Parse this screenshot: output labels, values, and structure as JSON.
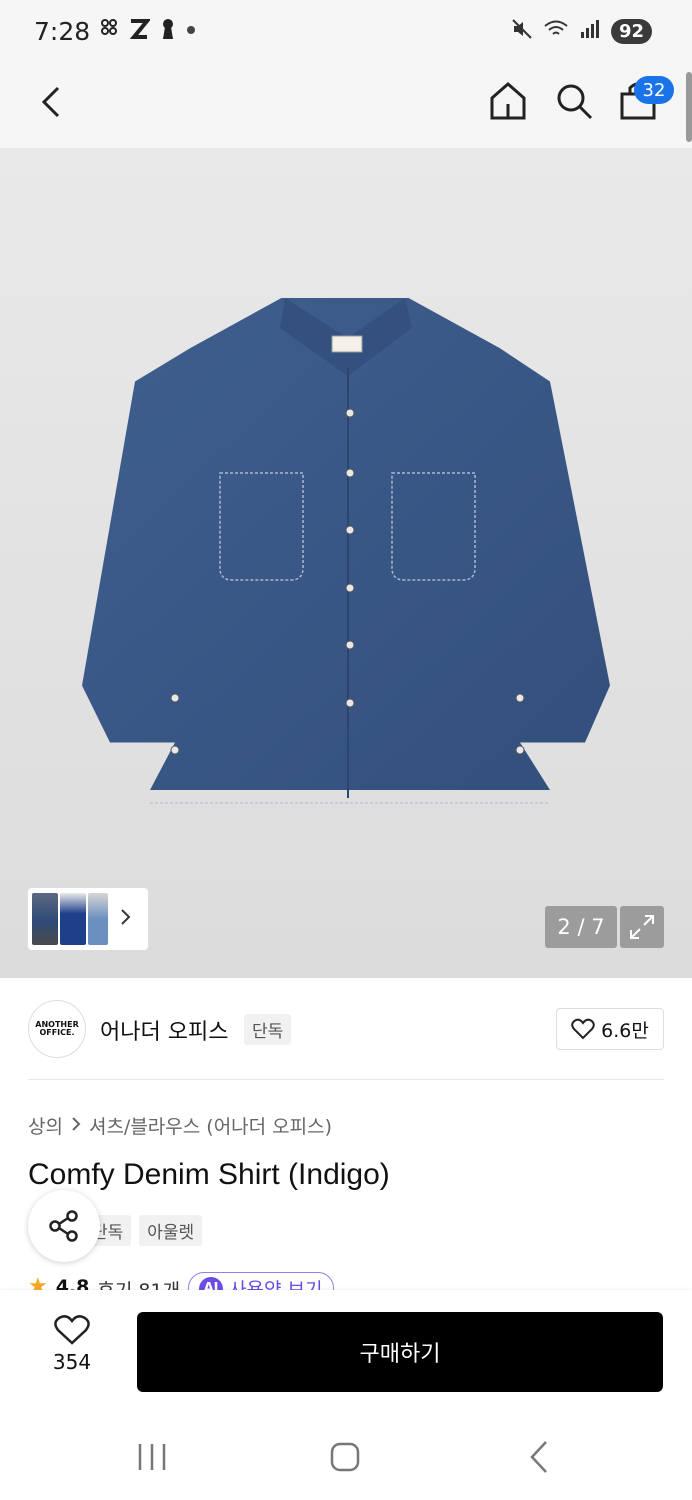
{
  "status_bar": {
    "time": "7:28",
    "left_icons": [
      "grid-icon",
      "z-icon",
      "keyhole-icon",
      "dot-icon"
    ],
    "battery": "92"
  },
  "top_nav": {
    "cart_badge": "32"
  },
  "gallery": {
    "page_indicator": "2 / 7"
  },
  "brand": {
    "logo_line1": "ANOTHER",
    "logo_line2": "OFFICE.",
    "name": "어나더 오피스",
    "badge": "단독",
    "like_count": "6.6만"
  },
  "product": {
    "breadcrumb_category": "상의",
    "breadcrumb_sub": "셔츠/블라우스 (어나더 오피스)",
    "title": "Comfy Denim Shirt (Indigo)",
    "tags": [
      "단독",
      "아울렛"
    ],
    "rating": "4.8",
    "review_text": "후기 81개",
    "ai_label": "AI",
    "ai_button": "사용약 보기"
  },
  "purchase_bar": {
    "like_count": "354",
    "buy_label": "구매하기"
  },
  "colors": {
    "accent": "#1a73e8",
    "buy_button": "#000000",
    "ai_purple": "#6b4de6",
    "star": "#f5a623"
  }
}
